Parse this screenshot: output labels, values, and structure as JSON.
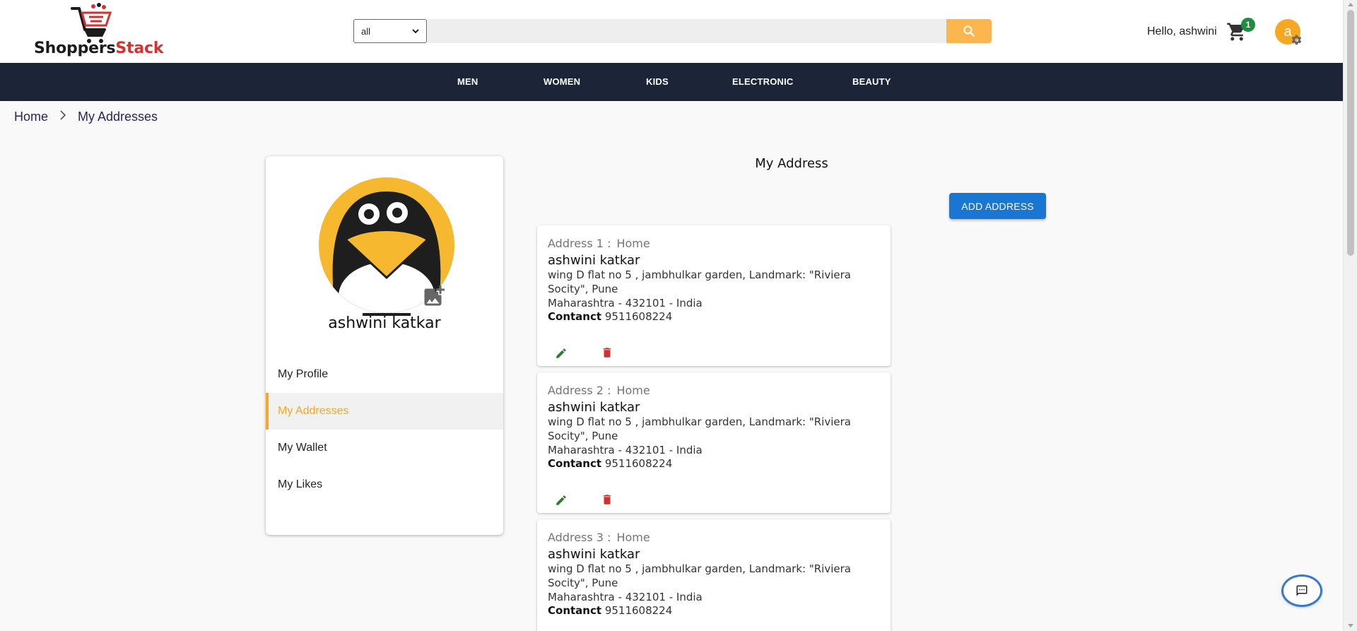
{
  "header": {
    "logo": {
      "part1": "Shoppers",
      "part2": "Stack"
    },
    "category_select": {
      "value": "all"
    },
    "search": {
      "placeholder": ""
    },
    "greeting": "Hello, ashwini",
    "cart_count": "1",
    "avatar_letter": "a"
  },
  "nav": {
    "items": [
      {
        "label": "MEN"
      },
      {
        "label": "WOMEN"
      },
      {
        "label": "KIDS"
      },
      {
        "label": "ELECTRONIC"
      },
      {
        "label": "BEAUTY"
      }
    ]
  },
  "breadcrumb": {
    "home": "Home",
    "current": "My Addresses"
  },
  "sidebar": {
    "name": "ashwini katkar",
    "menu": [
      {
        "label": "My Profile",
        "active": false
      },
      {
        "label": "My Addresses",
        "active": true
      },
      {
        "label": "My Wallet",
        "active": false
      },
      {
        "label": "My Likes",
        "active": false
      }
    ]
  },
  "main": {
    "title": "My Address",
    "add_button": "ADD ADDRESS",
    "addresses": [
      {
        "label": "Address 1 :",
        "type": "Home",
        "name": "ashwini katkar",
        "line1": "wing D flat no 5 , jambhulkar garden, Landmark: \"Riviera Socity\", Pune",
        "line2": "Maharashtra - 432101 - India",
        "contact_label": "Contanct",
        "contact": "9511608224"
      },
      {
        "label": "Address 2 :",
        "type": "Home",
        "name": "ashwini katkar",
        "line1": "wing D flat no 5 , jambhulkar garden, Landmark: \"Riviera Socity\", Pune",
        "line2": "Maharashtra - 432101 - India",
        "contact_label": "Contanct",
        "contact": "9511608224"
      },
      {
        "label": "Address 3 :",
        "type": "Home",
        "name": "ashwini katkar",
        "line1": "wing D flat no 5 , jambhulkar garden, Landmark: \"Riviera Socity\", Pune",
        "line2": "Maharashtra - 432101 - India",
        "contact_label": "Contanct",
        "contact": "9511608224"
      }
    ]
  },
  "icons": {
    "search": "search-icon",
    "cart": "cart-icon",
    "settings": "gear-icon",
    "add_photo": "add-photo-icon",
    "edit": "pencil-icon",
    "delete": "trash-icon",
    "chat": "chat-icon"
  },
  "colors": {
    "accent": "#f7a823",
    "nav_bg": "#1b2537",
    "primary_button": "#1976d2",
    "search_button": "#fbb64f",
    "edit": "#2e7d32",
    "delete": "#d32f2f",
    "badge": "#1e8e3e"
  }
}
